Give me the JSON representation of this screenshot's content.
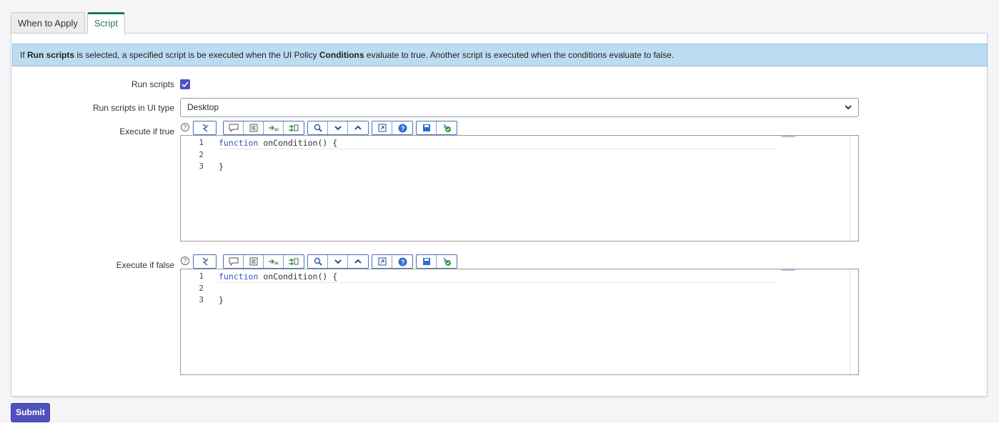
{
  "tabs": [
    {
      "label": "When to Apply",
      "active": false
    },
    {
      "label": "Script",
      "active": true
    }
  ],
  "info": {
    "part1": "If ",
    "bold1": "Run scripts",
    "part2": " is selected, a specified script is be executed when the UI Policy ",
    "bold2": "Conditions",
    "part3": " evaluate to true. Another script is executed when the conditions evaluate to false."
  },
  "form": {
    "run_scripts_label": "Run scripts",
    "run_scripts_checked": true,
    "ui_type_label": "Run scripts in UI type",
    "ui_type_value": "Desktop",
    "execute_true_label": "Execute if true",
    "execute_false_label": "Execute if false"
  },
  "editors": {
    "true_script": {
      "line_numbers": [
        "1",
        "2",
        "3"
      ],
      "keyword": "function",
      "line1_rest": " onCondition() {",
      "line2": "",
      "line3": "}"
    },
    "false_script": {
      "line_numbers": [
        "1",
        "2",
        "3"
      ],
      "keyword": "function",
      "line1_rest": " onCondition() {",
      "line2": "",
      "line3": "}"
    }
  },
  "toolbar_icons": [
    "script-debugger-icon",
    "comment-icon",
    "format-code-icon",
    "replace-icon",
    "replace-all-icon",
    "search-icon",
    "find-next-icon",
    "find-previous-icon",
    "fullscreen-icon",
    "help-icon",
    "save-icon",
    "syntax-check-icon"
  ],
  "submit_label": "Submit",
  "colors": {
    "accent": "#4f52bd",
    "tab_active": "#1a7a5e",
    "info_bg": "#bcdcf2"
  }
}
